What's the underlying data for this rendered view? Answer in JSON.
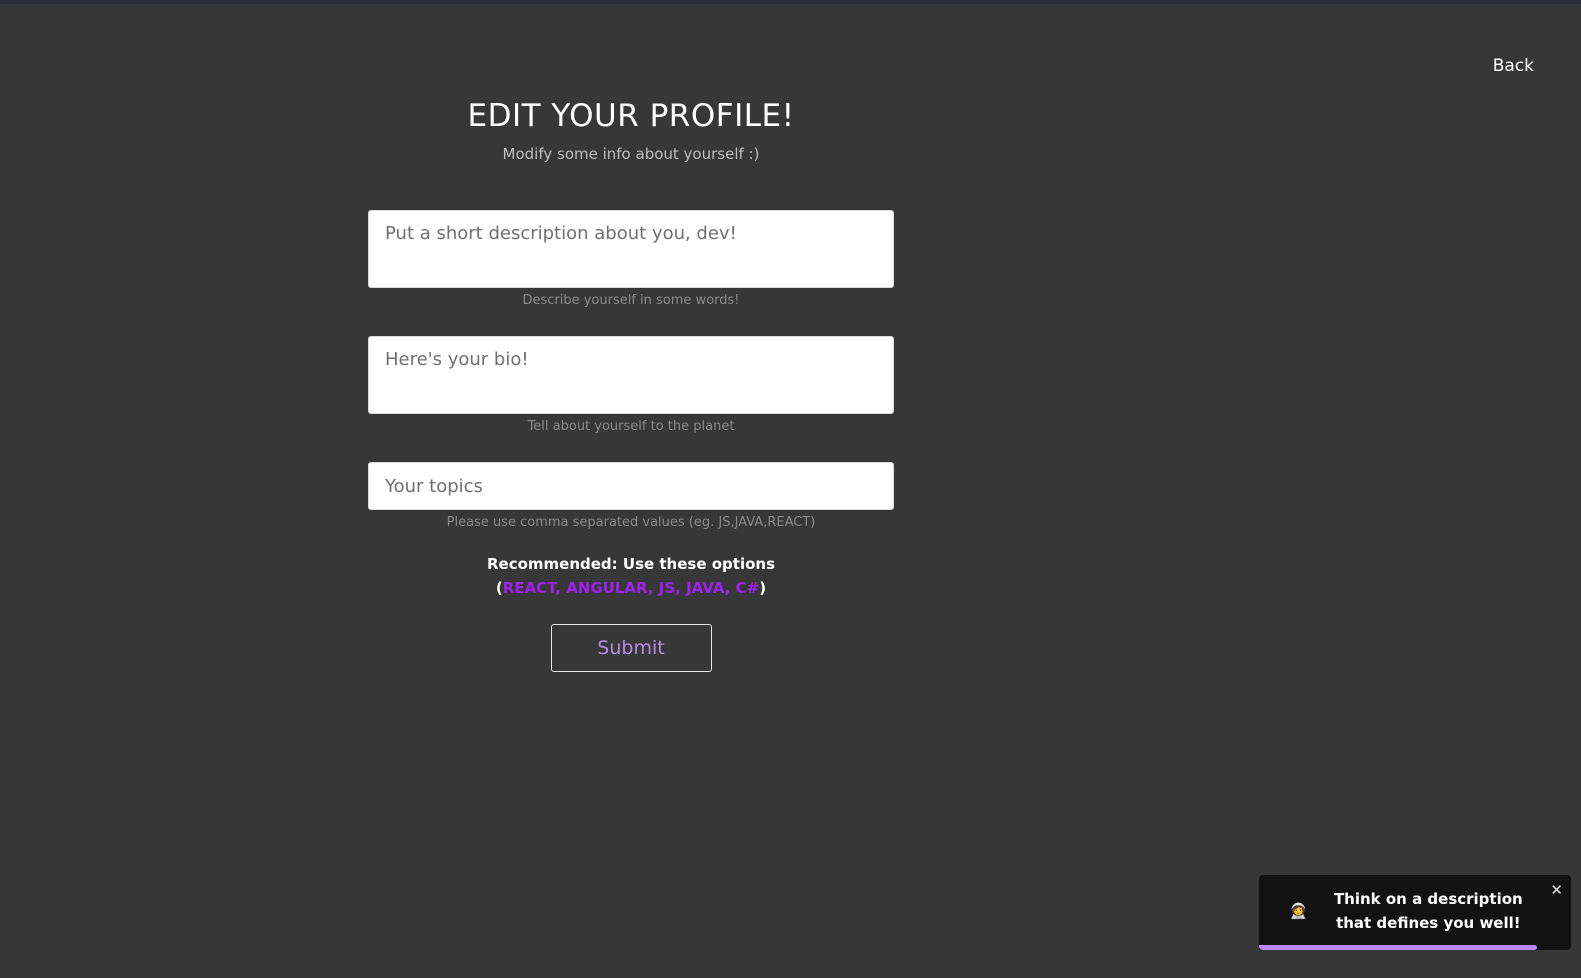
{
  "nav": {
    "back_label": "Back"
  },
  "header": {
    "title": "EDIT YOUR PROFILE!",
    "subtitle": "Modify some info about yourself :)"
  },
  "form": {
    "description": {
      "placeholder": "Put a short description about you, dev!",
      "value": "",
      "helper": "Describe yourself in some words!"
    },
    "bio": {
      "placeholder": "Here's your bio!",
      "value": "",
      "helper": "Tell about yourself to the planet"
    },
    "topics": {
      "placeholder": "Your topics",
      "value": "",
      "helper": "Please use comma separated values (eg. JS,JAVA,REACT)"
    },
    "recommend_label": "Recommended: Use these options",
    "recommend_open": "(",
    "recommend_options": "REACT, ANGULAR, JS, JAVA, C#",
    "recommend_close": ")",
    "submit_label": "Submit"
  },
  "toast": {
    "icon": "astronaut-icon",
    "icon_glyph": "🧑‍🚀",
    "message": "Think on a description that defines you well!",
    "close_glyph": "✕",
    "progress": 0.89
  },
  "colors": {
    "background": "#373737",
    "accent": "#a021f0",
    "submit_text": "#b98ae6",
    "toast_bg": "#121212",
    "toast_progress": "#bb86fc"
  }
}
